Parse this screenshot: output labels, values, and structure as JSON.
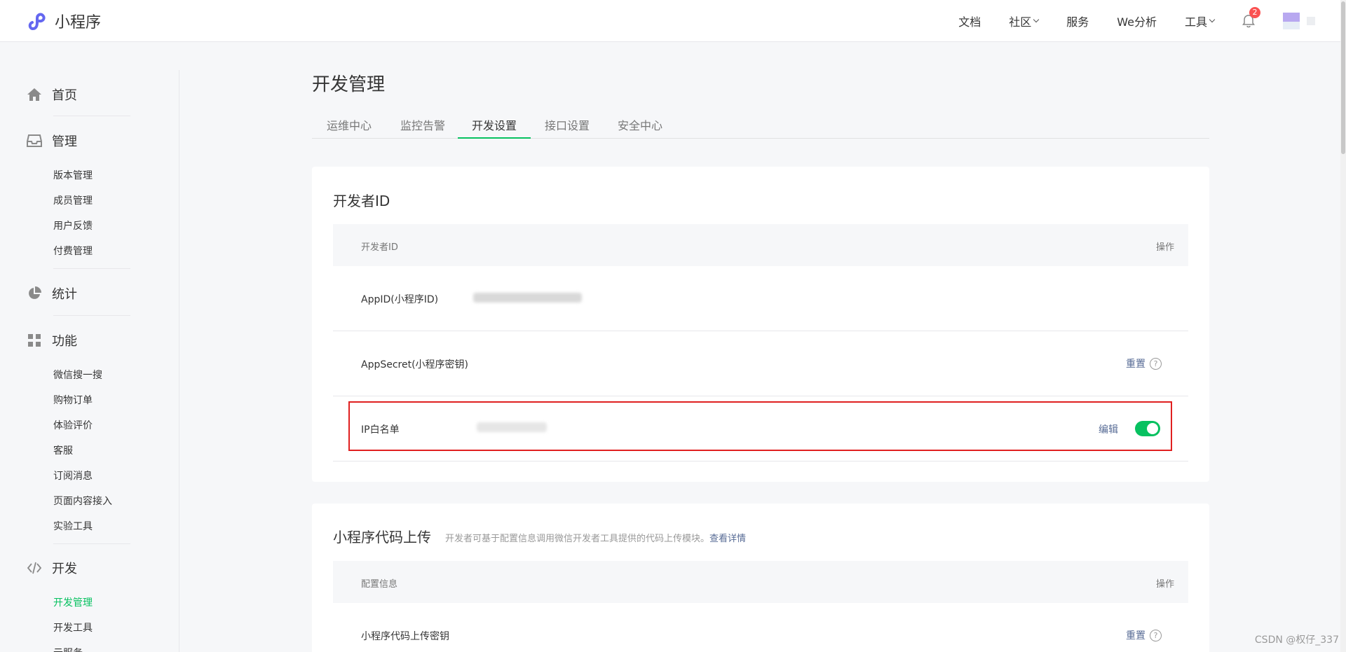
{
  "header": {
    "app_name": "小程序",
    "nav": [
      {
        "label": "文档",
        "has_dropdown": false
      },
      {
        "label": "社区",
        "has_dropdown": true
      },
      {
        "label": "服务",
        "has_dropdown": false
      },
      {
        "label": "We分析",
        "has_dropdown": false
      },
      {
        "label": "工具",
        "has_dropdown": true
      }
    ],
    "notification_count": "2",
    "accent_color": "#07c160",
    "badge_color": "#fa5151"
  },
  "sidebar": {
    "sections": [
      {
        "label": "首页",
        "icon": "home-icon"
      },
      {
        "label": "管理",
        "icon": "inbox-icon",
        "items": [
          "版本管理",
          "成员管理",
          "用户反馈",
          "付费管理"
        ]
      },
      {
        "label": "统计",
        "icon": "pie-chart-icon"
      },
      {
        "label": "功能",
        "icon": "grid-icon",
        "items": [
          "微信搜一搜",
          "购物订单",
          "体验评价",
          "客服",
          "订阅消息",
          "页面内容接入",
          "实验工具"
        ]
      },
      {
        "label": "开发",
        "icon": "code-icon",
        "items": [
          "开发管理",
          "开发工具",
          "云服务"
        ]
      }
    ],
    "active_item": "开发管理"
  },
  "main": {
    "page_title": "开发管理",
    "tabs": [
      "运维中心",
      "监控告警",
      "开发设置",
      "接口设置",
      "安全中心"
    ],
    "active_tab": "开发设置",
    "developer_card": {
      "title": "开发者ID",
      "head_left": "开发者ID",
      "head_right": "操作",
      "rows": [
        {
          "label": "AppID(小程序ID)",
          "action": ""
        },
        {
          "label": "AppSecret(小程序密钥)",
          "action": "重置"
        },
        {
          "label": "IP白名单",
          "action": "编辑",
          "toggle_on": true
        }
      ]
    },
    "upload_card": {
      "title": "小程序代码上传",
      "description": "开发者可基于配置信息调用微信开发者工具提供的代码上传模块。",
      "description_link": "查看详情",
      "head_left": "配置信息",
      "head_right": "操作",
      "rows": [
        {
          "label": "小程序代码上传密钥",
          "action": "重置"
        }
      ]
    }
  },
  "watermark": "CSDN @权仔_337"
}
